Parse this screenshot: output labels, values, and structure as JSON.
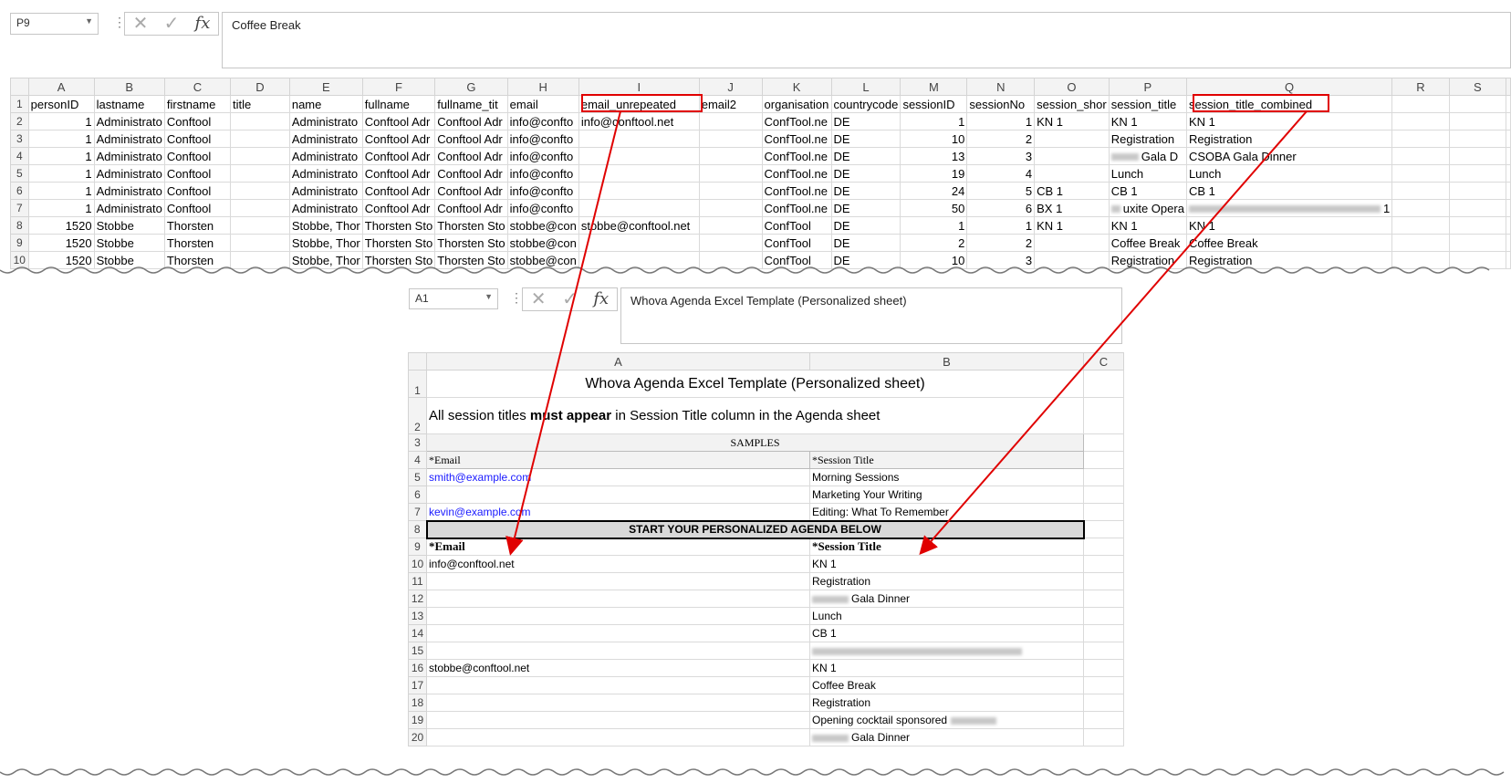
{
  "top": {
    "namebox": "P9",
    "formula": "Coffee Break",
    "columns": [
      "A",
      "B",
      "C",
      "D",
      "E",
      "F",
      "G",
      "H",
      "I",
      "J",
      "K",
      "L",
      "M",
      "N",
      "O",
      "P",
      "Q",
      "R",
      "S"
    ],
    "rows": [
      {
        "n": "1",
        "c": [
          "personID",
          "lastname",
          "firstname",
          "title",
          "name",
          "fullname",
          "fullname_tit",
          "email",
          "email_unrepeated",
          "email2",
          "organisation",
          "countrycode",
          "sessionID",
          "sessionNo",
          "session_shor",
          "session_title",
          "session_title_combined",
          "",
          ""
        ]
      },
      {
        "n": "2",
        "c": [
          "1",
          "Administrato",
          "Conftool",
          "",
          "Administrato",
          "Conftool Adr",
          "Conftool Adr",
          "info@confto",
          "info@conftool.net",
          "",
          "ConfTool.ne",
          "DE",
          "1",
          "1",
          "KN 1",
          "KN 1",
          "KN 1",
          "",
          ""
        ]
      },
      {
        "n": "3",
        "c": [
          "1",
          "Administrato",
          "Conftool",
          "",
          "Administrato",
          "Conftool Adr",
          "Conftool Adr",
          "info@confto",
          "",
          "",
          "ConfTool.ne",
          "DE",
          "10",
          "2",
          "",
          "Registration",
          "Registration",
          "",
          ""
        ]
      },
      {
        "n": "4",
        "c": [
          "1",
          "Administrato",
          "Conftool",
          "",
          "Administrato",
          "Conftool Adr",
          "Conftool Adr",
          "info@confto",
          "",
          "",
          "ConfTool.ne",
          "DE",
          "13",
          "3",
          "",
          "Gala D",
          "CSOBA Gala Dinner",
          "",
          ""
        ]
      },
      {
        "n": "5",
        "c": [
          "1",
          "Administrato",
          "Conftool",
          "",
          "Administrato",
          "Conftool Adr",
          "Conftool Adr",
          "info@confto",
          "",
          "",
          "ConfTool.ne",
          "DE",
          "19",
          "4",
          "",
          "Lunch",
          "Lunch",
          "",
          ""
        ]
      },
      {
        "n": "6",
        "c": [
          "1",
          "Administrato",
          "Conftool",
          "",
          "Administrato",
          "Conftool Adr",
          "Conftool Adr",
          "info@confto",
          "",
          "",
          "ConfTool.ne",
          "DE",
          "24",
          "5",
          "CB 1",
          "CB 1",
          "CB 1",
          "",
          ""
        ]
      },
      {
        "n": "7",
        "c": [
          "1",
          "Administrato",
          "Conftool",
          "",
          "Administrato",
          "Conftool Adr",
          "Conftool Adr",
          "info@confto",
          "",
          "",
          "ConfTool.ne",
          "DE",
          "50",
          "6",
          "BX 1",
          "uxite Opera",
          "1",
          "",
          ""
        ]
      },
      {
        "n": "8",
        "c": [
          "1520",
          "Stobbe",
          "Thorsten",
          "",
          "Stobbe, Thor",
          "Thorsten Sto",
          "Thorsten Sto",
          "stobbe@con",
          "stobbe@conftool.net",
          "",
          "ConfTool",
          "DE",
          "1",
          "1",
          "KN 1",
          "KN 1",
          "KN 1",
          "",
          ""
        ]
      },
      {
        "n": "9",
        "c": [
          "1520",
          "Stobbe",
          "Thorsten",
          "",
          "Stobbe, Thor",
          "Thorsten Sto",
          "Thorsten Sto",
          "stobbe@con",
          "",
          "",
          "ConfTool",
          "DE",
          "2",
          "2",
          "",
          "Coffee Break",
          "Coffee Break",
          "",
          ""
        ]
      },
      {
        "n": "10",
        "c": [
          "1520",
          "Stobbe",
          "Thorsten",
          "",
          "Stobbe, Thor",
          "Thorsten Sto",
          "Thorsten Sto",
          "stobbe@con",
          "",
          "",
          "ConfTool",
          "DE",
          "10",
          "3",
          "",
          "Registration",
          "Registration",
          "",
          ""
        ]
      }
    ]
  },
  "bottom": {
    "namebox": "A1",
    "formula": "Whova Agenda Excel Template (Personalized sheet)",
    "columns": [
      "A",
      "B",
      "C"
    ],
    "title": "Whova Agenda Excel Template (Personalized sheet)",
    "note_prefix": "All session titles ",
    "note_bold": "must appear",
    "note_suffix": " in Session Title column in the Agenda sheet",
    "samples_header": "SAMPLES",
    "sample_email_header": "*Email",
    "sample_session_header": "*Session Title",
    "samples": [
      {
        "n": "5",
        "email": "smith@example.com",
        "session": "Morning Sessions"
      },
      {
        "n": "6",
        "email": "",
        "session": "Marketing Your Writing"
      },
      {
        "n": "7",
        "email": "kevin@example.com",
        "session": "Editing: What To Remember"
      }
    ],
    "start_banner": "START YOUR PERSONALIZED AGENDA BELOW",
    "email_header": "*Email",
    "session_header": "*Session Title",
    "rows": [
      {
        "n": "10",
        "email": "info@conftool.net",
        "session": "KN 1"
      },
      {
        "n": "11",
        "email": "",
        "session": "Registration"
      },
      {
        "n": "12",
        "email": "",
        "session": "Gala Dinner"
      },
      {
        "n": "13",
        "email": "",
        "session": "Lunch"
      },
      {
        "n": "14",
        "email": "",
        "session": "CB 1"
      },
      {
        "n": "15",
        "email": "",
        "session": ""
      },
      {
        "n": "16",
        "email": "stobbe@conftool.net",
        "session": "KN 1"
      },
      {
        "n": "17",
        "email": "",
        "session": "Coffee Break"
      },
      {
        "n": "18",
        "email": "",
        "session": "Registration"
      },
      {
        "n": "19",
        "email": "",
        "session": "Opening cocktail sponsored"
      },
      {
        "n": "20",
        "email": "",
        "session": "Gala Dinner"
      }
    ]
  },
  "colors": {
    "arrow": "#e00000",
    "highlight_box": "#e00000",
    "link": "#1a1aff"
  }
}
